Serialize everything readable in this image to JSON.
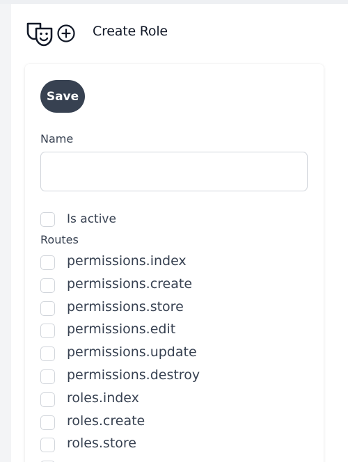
{
  "header": {
    "title": "Create Role",
    "icons": [
      "masks-icon",
      "plus-circle-icon"
    ]
  },
  "form": {
    "save_label": "Save",
    "name_label": "Name",
    "name_value": "",
    "is_active_label": "Is active",
    "is_active_checked": false,
    "routes_label": "Routes",
    "routes": [
      {
        "label": "permissions.index",
        "checked": false
      },
      {
        "label": "permissions.create",
        "checked": false
      },
      {
        "label": "permissions.store",
        "checked": false
      },
      {
        "label": "permissions.edit",
        "checked": false
      },
      {
        "label": "permissions.update",
        "checked": false
      },
      {
        "label": "permissions.destroy",
        "checked": false
      },
      {
        "label": "roles.index",
        "checked": false
      },
      {
        "label": "roles.create",
        "checked": false
      },
      {
        "label": "roles.store",
        "checked": false
      }
    ]
  },
  "colors": {
    "save_button_bg": "#374151",
    "text": "#374151",
    "border": "#d1d5db"
  }
}
